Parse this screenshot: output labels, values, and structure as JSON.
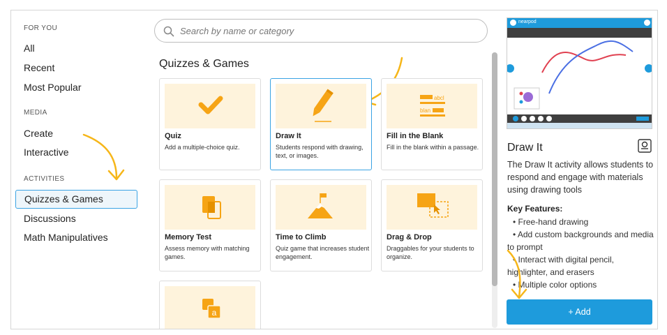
{
  "sidebar": {
    "sections": [
      {
        "header": "FOR YOU",
        "items": [
          "All",
          "Recent",
          "Most Popular"
        ]
      },
      {
        "header": "MEDIA",
        "items": [
          "Create",
          "Interactive"
        ]
      },
      {
        "header": "ACTIVITIES",
        "items": [
          "Quizzes & Games",
          "Discussions",
          "Math Manipulatives"
        ]
      }
    ],
    "selected": "Quizzes & Games"
  },
  "search": {
    "placeholder": "Search by name or category"
  },
  "main": {
    "section_title": "Quizzes & Games",
    "cards": [
      {
        "title": "Quiz",
        "desc": "Add a multiple-choice quiz.",
        "icon": "checkmark-icon"
      },
      {
        "title": "Draw It",
        "desc": "Students respond with drawing, text, or images.",
        "icon": "pencil-icon",
        "selected": true
      },
      {
        "title": "Fill in the Blank",
        "desc": "Fill in the blank within a passage.",
        "icon": "fill-blank-icon",
        "icon_text": [
          "abcl",
          "blan"
        ]
      },
      {
        "title": "Memory Test",
        "desc": "Assess memory with matching games.",
        "icon": "memory-cards-icon"
      },
      {
        "title": "Time to Climb",
        "desc": "Quiz game that increases student engagement.",
        "icon": "mountain-flag-icon"
      },
      {
        "title": "Drag & Drop",
        "desc": "Draggables for your students to organize.",
        "icon": "drag-drop-icon"
      },
      {
        "title": "",
        "desc": "",
        "icon": "letter-tiles-icon",
        "icon_text": "a"
      }
    ]
  },
  "panel": {
    "preview_brand": "nearpod",
    "title": "Draw It",
    "description": "The Draw It activity allows students to respond and engage with materials using drawing tools",
    "features_heading": "Key Features:",
    "features": [
      "• Free-hand drawing",
      "• Add custom backgrounds and media to prompt",
      "• Interact with digital pencil, highlighter, and erasers",
      "• Multiple color options"
    ],
    "add_label": "+ Add"
  },
  "colors": {
    "accent": "#1e9bdc",
    "highlight": "#f6b619",
    "card_bg": "#fef3dc"
  }
}
